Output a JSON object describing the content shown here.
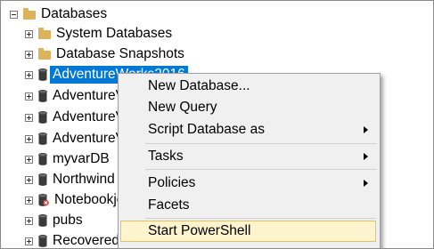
{
  "tree": {
    "root": {
      "label": "Databases"
    },
    "items": [
      {
        "label": "System Databases",
        "type": "folder"
      },
      {
        "label": "Database Snapshots",
        "type": "folder"
      },
      {
        "label": "AdventureWorks2016",
        "type": "database",
        "selected": true
      },
      {
        "label": "AdventureV",
        "type": "database"
      },
      {
        "label": "AdventureV",
        "type": "database"
      },
      {
        "label": "AdventureV",
        "type": "database"
      },
      {
        "label": "myvarDB",
        "type": "database"
      },
      {
        "label": "Northwind",
        "type": "database"
      },
      {
        "label": "Notebookje",
        "type": "database",
        "error": true
      },
      {
        "label": "pubs",
        "type": "database"
      },
      {
        "label": "Recovered",
        "type": "database"
      }
    ]
  },
  "context_menu": {
    "items": [
      {
        "label": "New Database..."
      },
      {
        "label": "New Query"
      },
      {
        "label": "Script Database as",
        "submenu": true
      },
      {
        "label": "Tasks",
        "submenu": true
      },
      {
        "label": "Policies",
        "submenu": true
      },
      {
        "label": "Facets"
      },
      {
        "label": "Start PowerShell",
        "highlighted": true
      }
    ]
  },
  "colors": {
    "selection": "#0078d7",
    "menu_background": "#f0f0f0",
    "menu_highlight": "#fff4ce",
    "folder": "#dcb35c"
  }
}
